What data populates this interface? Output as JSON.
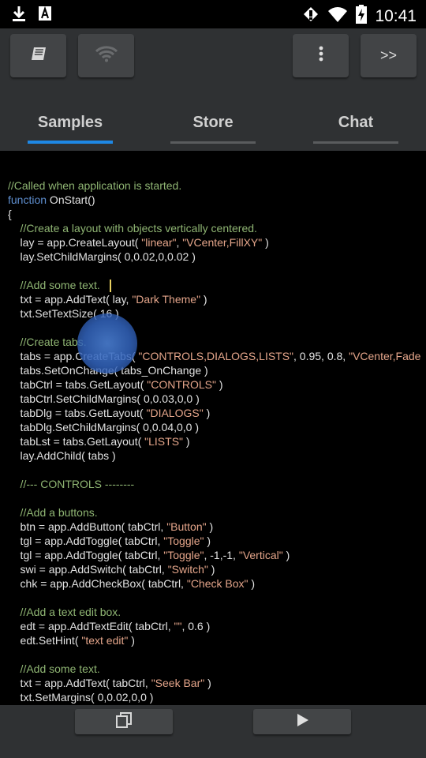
{
  "status": {
    "time": "10:41",
    "icons": [
      "download-icon",
      "a-icon",
      "vibrate-icon",
      "wifi-icon",
      "battery-charging-icon"
    ]
  },
  "toolbar": {
    "icons": [
      "book-icon",
      "wifi-icon",
      "more-vert-icon"
    ],
    "forward_label": ">>"
  },
  "tabs": [
    {
      "label": "Samples",
      "active": true
    },
    {
      "label": "Store",
      "active": false
    },
    {
      "label": "Chat",
      "active": false
    }
  ],
  "colors": {
    "accent": "#1e88e5",
    "inactive_underline": "#5a5c5e",
    "comment": "#8fb573",
    "keyword": "#5f8fd0",
    "string": "#e4a58a",
    "code_text": "#e2e2e2",
    "toolbar_bg": "#2f3133"
  },
  "code_lines": [
    [
      {
        "t": "//Called when application is started.",
        "c": "c"
      }
    ],
    [
      {
        "t": "function",
        "c": "k"
      },
      {
        "t": " OnStart()"
      }
    ],
    [
      {
        "t": "{"
      }
    ],
    [
      {
        "t": "    //Create a layout with objects vertically centered.",
        "c": "c"
      }
    ],
    [
      {
        "t": "    lay = app.CreateLayout( "
      },
      {
        "t": "\"linear\"",
        "c": "s"
      },
      {
        "t": ", "
      },
      {
        "t": "\"VCenter,FillXY\"",
        "c": "s"
      },
      {
        "t": " )"
      }
    ],
    [
      {
        "t": "    lay.SetChildMargins( 0,0.02,0,0.02 )"
      }
    ],
    [
      {
        "t": ""
      }
    ],
    [
      {
        "t": "    //Add some text.",
        "c": "c"
      }
    ],
    [
      {
        "t": "    txt = app.AddText( lay, "
      },
      {
        "t": "\"Dark Theme\"",
        "c": "s"
      },
      {
        "t": " )"
      }
    ],
    [
      {
        "t": "    txt.SetTextSize( 16 )"
      }
    ],
    [
      {
        "t": ""
      }
    ],
    [
      {
        "t": "    //Create tabs.",
        "c": "c"
      }
    ],
    [
      {
        "t": "    tabs = app.CreateTabs( "
      },
      {
        "t": "\"CONTROLS,DIALOGS,LISTS\"",
        "c": "s"
      },
      {
        "t": ", 0.95, 0.8, "
      },
      {
        "t": "\"VCenter,Fade",
        "c": "s"
      }
    ],
    [
      {
        "t": "    tabs.SetOnChange( tabs_OnChange )"
      }
    ],
    [
      {
        "t": "    tabCtrl = tabs.GetLayout( "
      },
      {
        "t": "\"CONTROLS\"",
        "c": "s"
      },
      {
        "t": " )"
      }
    ],
    [
      {
        "t": "    tabCtrl.SetChildMargins( 0,0.03,0,0 )"
      }
    ],
    [
      {
        "t": "    tabDlg = tabs.GetLayout( "
      },
      {
        "t": "\"DIALOGS\"",
        "c": "s"
      },
      {
        "t": " )"
      }
    ],
    [
      {
        "t": "    tabDlg.SetChildMargins( 0,0.04,0,0 )"
      }
    ],
    [
      {
        "t": "    tabLst = tabs.GetLayout( "
      },
      {
        "t": "\"LISTS\"",
        "c": "s"
      },
      {
        "t": " )"
      }
    ],
    [
      {
        "t": "    lay.AddChild( tabs )"
      }
    ],
    [
      {
        "t": ""
      }
    ],
    [
      {
        "t": "    //--- CONTROLS --------",
        "c": "c"
      }
    ],
    [
      {
        "t": ""
      }
    ],
    [
      {
        "t": "    //Add a buttons.",
        "c": "c"
      }
    ],
    [
      {
        "t": "    btn = app.AddButton( tabCtrl, "
      },
      {
        "t": "\"Button\"",
        "c": "s"
      },
      {
        "t": " )"
      }
    ],
    [
      {
        "t": "    tgl = app.AddToggle( tabCtrl, "
      },
      {
        "t": "\"Toggle\"",
        "c": "s"
      },
      {
        "t": " )"
      }
    ],
    [
      {
        "t": "    tgl = app.AddToggle( tabCtrl, "
      },
      {
        "t": "\"Toggle\"",
        "c": "s"
      },
      {
        "t": ", -1,-1, "
      },
      {
        "t": "\"Vertical\"",
        "c": "s"
      },
      {
        "t": " )"
      }
    ],
    [
      {
        "t": "    swi = app.AddSwitch( tabCtrl, "
      },
      {
        "t": "\"Switch\"",
        "c": "s"
      },
      {
        "t": " )"
      }
    ],
    [
      {
        "t": "    chk = app.AddCheckBox( tabCtrl, "
      },
      {
        "t": "\"Check Box\"",
        "c": "s"
      },
      {
        "t": " )"
      }
    ],
    [
      {
        "t": ""
      }
    ],
    [
      {
        "t": "    //Add a text edit box.",
        "c": "c"
      }
    ],
    [
      {
        "t": "    edt = app.AddTextEdit( tabCtrl, "
      },
      {
        "t": "\"\"",
        "c": "s"
      },
      {
        "t": ", 0.6 )"
      }
    ],
    [
      {
        "t": "    edt.SetHint( "
      },
      {
        "t": "\"text edit\"",
        "c": "s"
      },
      {
        "t": " )"
      }
    ],
    [
      {
        "t": ""
      }
    ],
    [
      {
        "t": "    //Add some text.",
        "c": "c"
      }
    ],
    [
      {
        "t": "    txt = app.AddText( tabCtrl, "
      },
      {
        "t": "\"Seek Bar\"",
        "c": "s"
      },
      {
        "t": " )"
      }
    ],
    [
      {
        "t": "    txt.SetMargins( 0,0.02,0,0 )"
      }
    ]
  ],
  "bottom": {
    "icons": [
      "copy-icon",
      "play-icon"
    ]
  }
}
